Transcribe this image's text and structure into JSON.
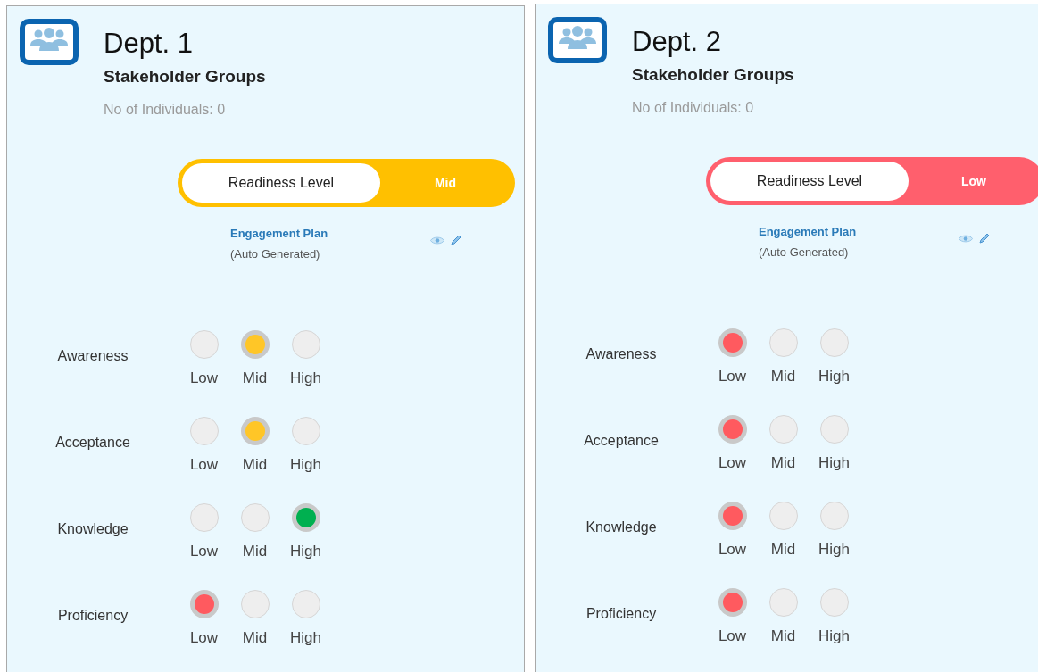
{
  "departments": [
    {
      "title": "Dept. 1",
      "subtitle": "Stakeholder Groups",
      "count": "No of Individuals: 0",
      "readiness": {
        "label": "Readiness Level",
        "value": "Mid",
        "color": "#ffc000"
      },
      "plan": {
        "link": "Engagement Plan",
        "note": "(Auto Generated)"
      },
      "metrics": [
        {
          "name": "Awareness",
          "color": "#ffc627",
          "options": [
            {
              "label": "Low",
              "selected": false
            },
            {
              "label": "Mid",
              "selected": true
            },
            {
              "label": "High",
              "selected": false
            }
          ]
        },
        {
          "name": "Acceptance",
          "color": "#ffc627",
          "options": [
            {
              "label": "Low",
              "selected": false
            },
            {
              "label": "Mid",
              "selected": true
            },
            {
              "label": "High",
              "selected": false
            }
          ]
        },
        {
          "name": "Knowledge",
          "color": "#00b050",
          "options": [
            {
              "label": "Low",
              "selected": false
            },
            {
              "label": "Mid",
              "selected": false
            },
            {
              "label": "High",
              "selected": true
            }
          ]
        },
        {
          "name": "Proficiency",
          "color": "#ff5a5f",
          "options": [
            {
              "label": "Low",
              "selected": true
            },
            {
              "label": "Mid",
              "selected": false
            },
            {
              "label": "High",
              "selected": false
            }
          ]
        }
      ]
    },
    {
      "title": "Dept. 2",
      "subtitle": "Stakeholder Groups",
      "count": "No of Individuals: 0",
      "readiness": {
        "label": "Readiness Level",
        "value": "Low",
        "color": "#ff5f6d"
      },
      "plan": {
        "link": "Engagement Plan",
        "note": "(Auto Generated)"
      },
      "metrics": [
        {
          "name": "Awareness",
          "color": "#ff5a5f",
          "options": [
            {
              "label": "Low",
              "selected": true
            },
            {
              "label": "Mid",
              "selected": false
            },
            {
              "label": "High",
              "selected": false
            }
          ]
        },
        {
          "name": "Acceptance",
          "color": "#ff5a5f",
          "options": [
            {
              "label": "Low",
              "selected": true
            },
            {
              "label": "Mid",
              "selected": false
            },
            {
              "label": "High",
              "selected": false
            }
          ]
        },
        {
          "name": "Knowledge",
          "color": "#ff5a5f",
          "options": [
            {
              "label": "Low",
              "selected": true
            },
            {
              "label": "Mid",
              "selected": false
            },
            {
              "label": "High",
              "selected": false
            }
          ]
        },
        {
          "name": "Proficiency",
          "color": "#ff5a5f",
          "options": [
            {
              "label": "Low",
              "selected": true
            },
            {
              "label": "Mid",
              "selected": false
            },
            {
              "label": "High",
              "selected": false
            }
          ]
        }
      ]
    }
  ]
}
